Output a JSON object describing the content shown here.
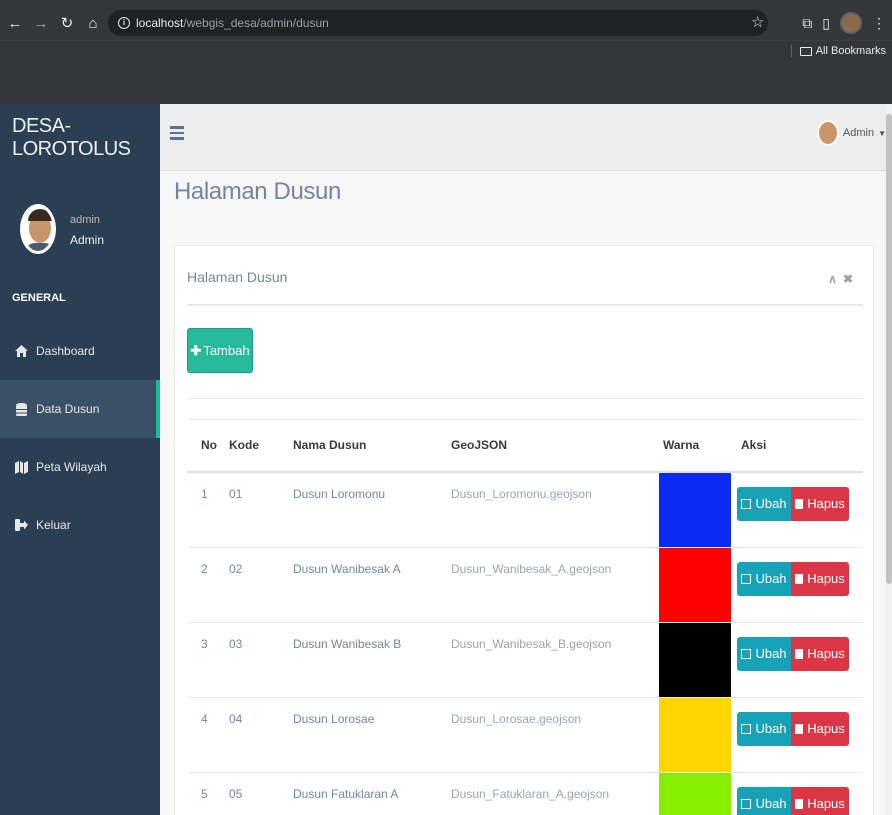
{
  "browser": {
    "url_host": "localhost",
    "url_path": "/webgis_desa/admin/dusun",
    "bookmarks_label": "All Bookmarks"
  },
  "sidebar": {
    "site_title": "DESA-LOROTOLUS",
    "profile_small": "admin",
    "profile_name": "Admin",
    "section": "GENERAL",
    "items": [
      {
        "label": "Dashboard",
        "icon": "home-icon"
      },
      {
        "label": "Data Dusun",
        "icon": "database-icon"
      },
      {
        "label": "Peta Wilayah",
        "icon": "map-icon"
      },
      {
        "label": "Keluar",
        "icon": "sign-out-icon"
      }
    ]
  },
  "topnav": {
    "user_label": "Admin"
  },
  "main": {
    "page_title": "Halaman Dusun",
    "panel_title": "Halaman Dusun",
    "add_button": "Tambah",
    "table": {
      "headers": [
        "No",
        "Kode",
        "Nama Dusun",
        "GeoJSON",
        "Warna",
        "Aksi"
      ],
      "rows": [
        {
          "no": "1",
          "kode": "01",
          "nama": "Dusun Loromonu",
          "geojson": "Dusun_Loromonu.geojson",
          "warna": "#0b2bf5"
        },
        {
          "no": "2",
          "kode": "02",
          "nama": "Dusun Wanibesak A",
          "geojson": "Dusun_Wanibesak_A.geojson",
          "warna": "#ff0000"
        },
        {
          "no": "3",
          "kode": "03",
          "nama": "Dusun Wanibesak B",
          "geojson": "Dusun_Wanibesak_B.geojson",
          "warna": "#000000"
        },
        {
          "no": "4",
          "kode": "04",
          "nama": "Dusun Lorosae",
          "geojson": "Dusun_Lorosae.geojson",
          "warna": "#ffd400"
        },
        {
          "no": "5",
          "kode": "05",
          "nama": "Dusun Fatuklaran A",
          "geojson": "Dusun_Fatuklaran_A.geojson",
          "warna": "#88ee00"
        }
      ],
      "edit_label": "Ubah",
      "delete_label": "Hapus"
    }
  },
  "colors": {
    "sidebar_bg": "#2a3f54",
    "accent": "#1abb9c",
    "add_button": "#26b99a",
    "edit_button": "#17a2b8",
    "delete_button": "#dc3545"
  }
}
